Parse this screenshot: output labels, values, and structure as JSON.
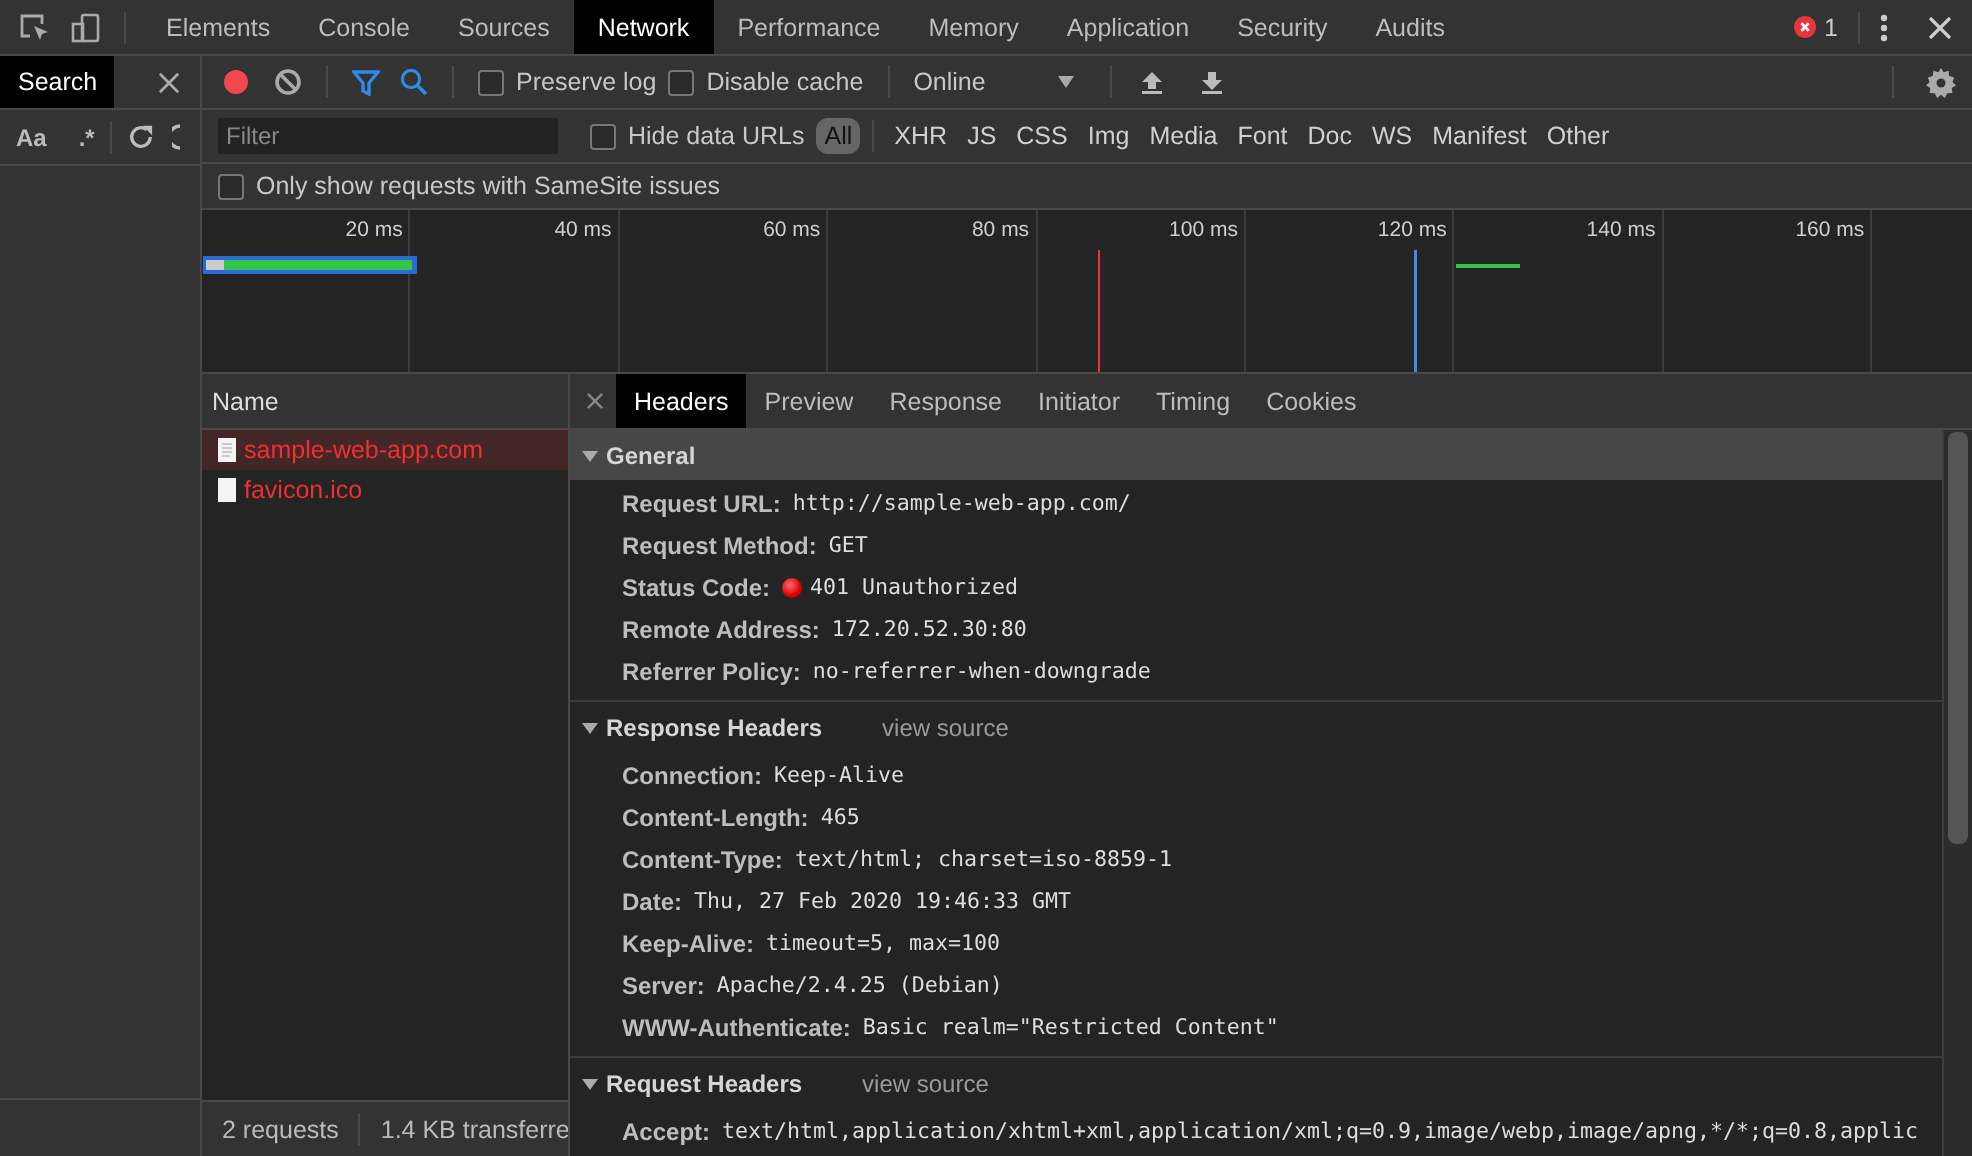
{
  "main_tabs": [
    {
      "label": "Elements",
      "selected": false
    },
    {
      "label": "Console",
      "selected": false
    },
    {
      "label": "Sources",
      "selected": false
    },
    {
      "label": "Network",
      "selected": true
    },
    {
      "label": "Performance",
      "selected": false
    },
    {
      "label": "Memory",
      "selected": false
    },
    {
      "label": "Application",
      "selected": false
    },
    {
      "label": "Security",
      "selected": false
    },
    {
      "label": "Audits",
      "selected": false
    }
  ],
  "error_count": "1",
  "search_panel": {
    "tab": "Search",
    "options": [
      "Aa",
      ".*"
    ]
  },
  "network_toolbar": {
    "recording": true,
    "preserve_log": {
      "label": "Preserve log",
      "checked": false
    },
    "disable_cache": {
      "label": "Disable cache",
      "checked": false
    },
    "throttling": "Online"
  },
  "filter_bar": {
    "placeholder": "Filter",
    "hide_data_urls": {
      "label": "Hide data URLs",
      "checked": false
    },
    "types": [
      {
        "label": "All",
        "selected": true
      },
      {
        "label": "XHR",
        "selected": false
      },
      {
        "label": "JS",
        "selected": false
      },
      {
        "label": "CSS",
        "selected": false
      },
      {
        "label": "Img",
        "selected": false
      },
      {
        "label": "Media",
        "selected": false
      },
      {
        "label": "Font",
        "selected": false
      },
      {
        "label": "Doc",
        "selected": false
      },
      {
        "label": "WS",
        "selected": false
      },
      {
        "label": "Manifest",
        "selected": false
      },
      {
        "label": "Other",
        "selected": false
      }
    ],
    "samesite": {
      "label": "Only show requests with SameSite issues",
      "checked": false
    }
  },
  "overview": {
    "ticks": [
      "20 ms",
      "40 ms",
      "60 ms",
      "80 ms",
      "100 ms",
      "120 ms",
      "140 ms",
      "160 ms"
    ]
  },
  "requests": {
    "column": "Name",
    "rows": [
      {
        "name": "sample-web-app.com",
        "selected": true,
        "failed": true
      },
      {
        "name": "favicon.ico",
        "selected": false,
        "failed": true
      }
    ]
  },
  "details": {
    "tabs": [
      {
        "label": "Headers",
        "selected": true
      },
      {
        "label": "Preview",
        "selected": false
      },
      {
        "label": "Response",
        "selected": false
      },
      {
        "label": "Initiator",
        "selected": false
      },
      {
        "label": "Timing",
        "selected": false
      },
      {
        "label": "Cookies",
        "selected": false
      }
    ],
    "sections": [
      {
        "title": "General",
        "expanded": true,
        "rows": [
          {
            "kind": "plain",
            "name": "Request URL:",
            "value": "http://sample-web-app.com/"
          },
          {
            "kind": "plain",
            "name": "Request Method:",
            "value": "GET"
          },
          {
            "kind": "status",
            "name": "Status Code:",
            "value": "401 Unauthorized"
          },
          {
            "kind": "plain",
            "name": "Remote Address:",
            "value": "172.20.52.30:80"
          },
          {
            "kind": "plain",
            "name": "Referrer Policy:",
            "value": "no-referrer-when-downgrade"
          }
        ]
      },
      {
        "title": "Response Headers",
        "link": "view source",
        "expanded": true,
        "rows": [
          {
            "kind": "plain",
            "name": "Connection:",
            "value": "Keep-Alive"
          },
          {
            "kind": "plain",
            "name": "Content-Length:",
            "value": "465"
          },
          {
            "kind": "plain",
            "name": "Content-Type:",
            "value": "text/html; charset=iso-8859-1"
          },
          {
            "kind": "plain",
            "name": "Date:",
            "value": "Thu, 27 Feb 2020 19:46:33 GMT"
          },
          {
            "kind": "plain",
            "name": "Keep-Alive:",
            "value": "timeout=5, max=100"
          },
          {
            "kind": "plain",
            "name": "Server:",
            "value": "Apache/2.4.25 (Debian)"
          },
          {
            "kind": "plain",
            "name": "WWW-Authenticate:",
            "value": "Basic realm=\"Restricted Content\""
          }
        ]
      },
      {
        "title": "Request Headers",
        "link": "view source",
        "expanded": true,
        "rows": [
          {
            "kind": "plain",
            "name": "Accept:",
            "value": "text/html,application/xhtml+xml,application/xml;q=0.9,image/webp,image/apng,*/*;q=0.8,applic"
          }
        ]
      }
    ]
  },
  "status_bar": [
    "2 requests",
    "1.4 KB transferre"
  ]
}
